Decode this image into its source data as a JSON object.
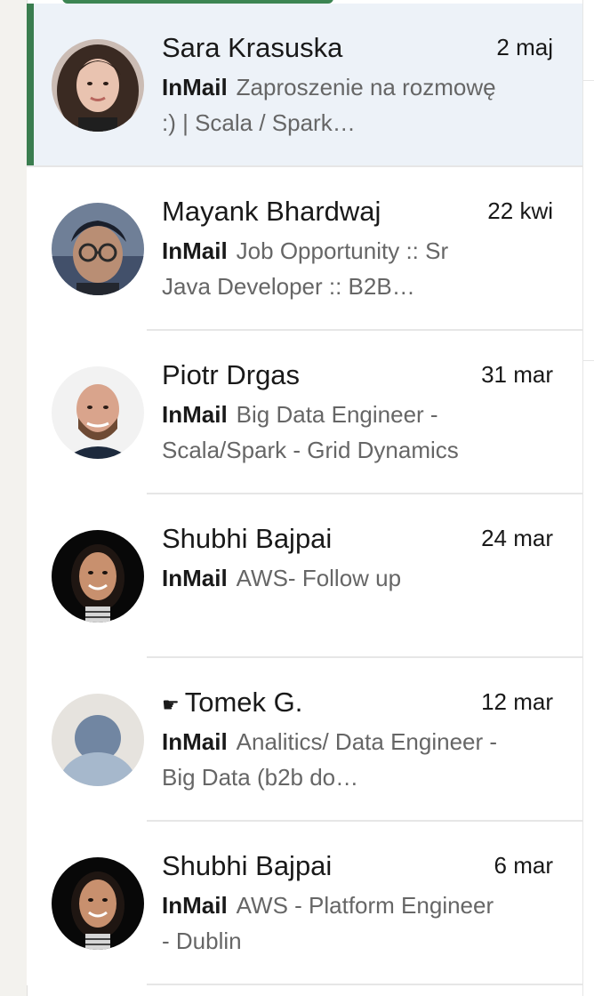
{
  "conversations": [
    {
      "name": "Sara Krasuska",
      "date": "2 maj",
      "tag": "InMail",
      "preview": "Zaproszenie na rozmowę :) | Scala / Spark…",
      "active": true
    },
    {
      "name": "Mayank Bhardwaj",
      "date": "22 kwi",
      "tag": "InMail",
      "preview": "Job Opportunity :: Sr Java Developer :: B2B…",
      "active": false
    },
    {
      "name": "Piotr Drgas",
      "date": "31 mar",
      "tag": "InMail",
      "preview": "Big Data Engineer - Scala/Spark - Grid Dynamics",
      "active": false
    },
    {
      "name": "Shubhi Bajpai",
      "date": "24 mar",
      "tag": "InMail",
      "preview": "AWS- Follow up",
      "active": false
    },
    {
      "name_prefix": "☛",
      "name": "Tomek G.",
      "date": "12 mar",
      "tag": "InMail",
      "preview": "Analitics/ Data Engineer - Big Data (b2b do…",
      "active": false
    },
    {
      "name": "Shubhi Bajpai",
      "date": "6 mar",
      "tag": "InMail",
      "preview": "AWS - Platform Engineer - Dublin",
      "active": false
    }
  ],
  "colors": {
    "active_bar": "#3a7d4f",
    "active_bg": "#edf2f8",
    "text_primary": "#191919",
    "text_secondary": "#666666"
  }
}
